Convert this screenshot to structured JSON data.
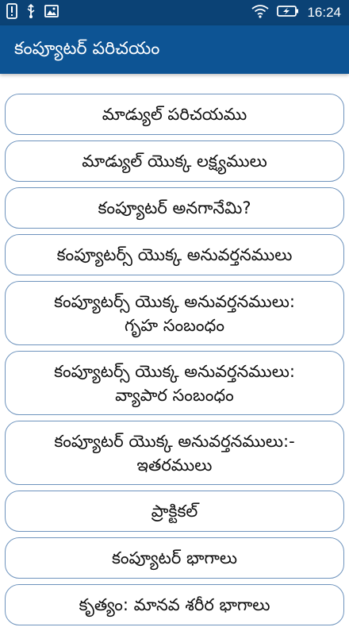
{
  "status_bar": {
    "time": "16:24",
    "icons": [
      "alert-icon",
      "usb-icon",
      "image-icon",
      "wifi-icon",
      "battery-charging-icon"
    ]
  },
  "app_bar": {
    "title": "కంప్యూటర్ పరిచయం"
  },
  "menu": {
    "items": [
      {
        "label": "మాడ్యుల్ పరిచయము"
      },
      {
        "label": "మాడ్యుల్ యొక్క లక్ష్యములు"
      },
      {
        "label": "కంప్యూటర్ అనగానేమి?"
      },
      {
        "label": "కంప్యూటర్స్ యొక్క అనువర్తనములు"
      },
      {
        "line1": "కంప్యూటర్స్ యొక్క అనువర్తనములు:",
        "line2": "గృహ సంబంధం"
      },
      {
        "line1": "కంప్యూటర్స్ యొక్క అనువర్తనములు:",
        "line2": "వ్యాపార  సంబంధం"
      },
      {
        "line1": "కంప్యూటర్ యొక్క అనువర్తనములు:-",
        "line2": "ఇతరములు"
      },
      {
        "label": "ప్రాక్టికల్"
      },
      {
        "label": "కంప్యూటర్ భాగాలు"
      },
      {
        "label": "కృత్యం: మానవ శరీర భాగాలు"
      }
    ]
  },
  "colors": {
    "status_bar": "#0b4275",
    "app_bar": "#0d5494",
    "item_border": "#6e93bd"
  }
}
